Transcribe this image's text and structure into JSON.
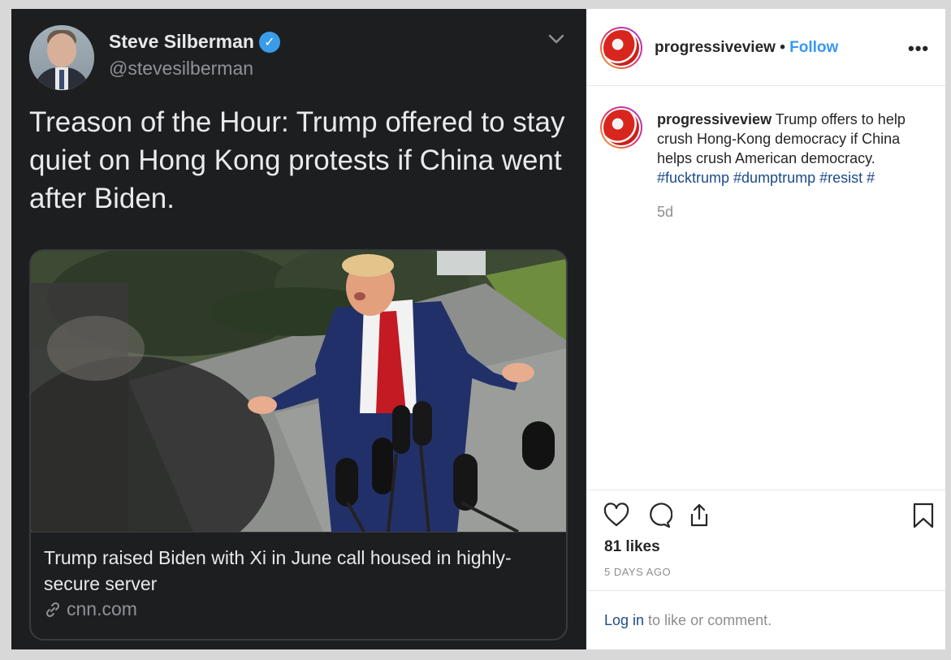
{
  "tweet": {
    "author_name": "Steve Silberman",
    "verified_icon": "verified-badge-icon",
    "handle": "@stevesilberman",
    "text": "Treason of the Hour: Trump offered to stay quiet on Hong Kong protests if China went after Biden.",
    "card": {
      "headline": "Trump raised Biden with Xi in June call housed in highly-secure server",
      "domain": "cnn.com"
    },
    "colors": {
      "background": "#1d1e20",
      "text": "#e9eaeb",
      "muted": "#8e9297",
      "verified": "#3a9ce8"
    }
  },
  "instagram": {
    "username": "progressiveview",
    "separator": "•",
    "follow_label": "Follow",
    "more_label": "•••",
    "caption_user": "progressiveview",
    "caption_text": "Trump offers to help crush Hong-Kong democracy if China helps crush American democracy.",
    "caption_hashtags": "#fucktrump #dumptrump #resist #",
    "age": "5d",
    "likes": "81 likes",
    "date": "5 DAYS AGO",
    "login_link": "Log in",
    "login_text": " to like or comment.",
    "icons": [
      "heart-icon",
      "comment-icon",
      "share-icon",
      "bookmark-icon"
    ],
    "colors": {
      "link": "#3897f0",
      "hashtag": "#1d4b89",
      "muted": "#8e8e8e"
    }
  }
}
